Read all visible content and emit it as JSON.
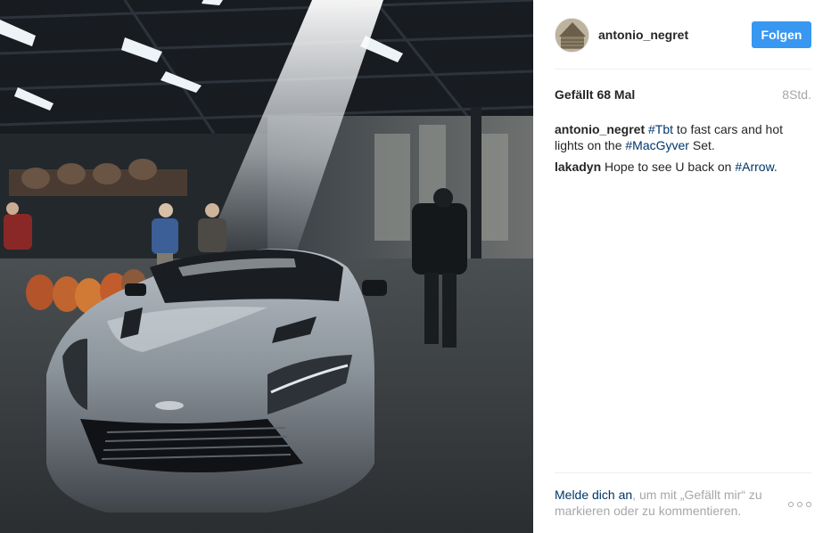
{
  "post": {
    "username": "antonio_negret",
    "follow_label": "Folgen",
    "likes": "Gefällt 68 Mal",
    "time_ago": "8Std."
  },
  "comments": [
    {
      "author": "antonio_negret",
      "segments": [
        {
          "text": "#Tbt",
          "tag": true
        },
        {
          "text": " to fast cars and hot lights on the ",
          "tag": false
        },
        {
          "text": "#MacGyver",
          "tag": true
        },
        {
          "text": " Set.",
          "tag": false
        }
      ]
    },
    {
      "author": "lakadyn",
      "segments": [
        {
          "text": "Hope to see U back on ",
          "tag": false
        },
        {
          "text": "#Arrow",
          "tag": true
        },
        {
          "text": ".",
          "tag": false
        }
      ]
    }
  ],
  "footer": {
    "login_link": "Melde dich an",
    "login_rest": ", um mit „Gefällt mir“ zu markieren oder zu kommentieren."
  },
  "icons": {
    "more": "more-options-icon"
  },
  "colors": {
    "accent": "#3897f0",
    "link": "#003569",
    "muted": "#a5a7aa"
  }
}
